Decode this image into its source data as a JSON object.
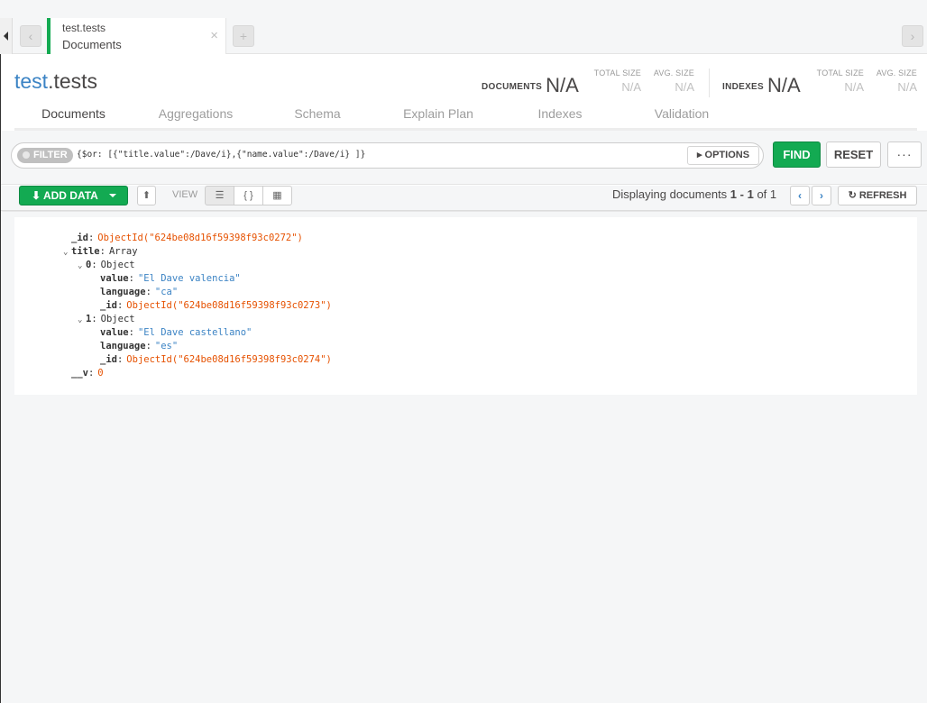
{
  "tabbar": {
    "back_icon": "chevron-left-icon",
    "forward_icon": "chevron-right-icon",
    "tab": {
      "namespace": "test.tests",
      "subtitle": "Documents",
      "close": "×"
    },
    "new_tab": "+"
  },
  "header": {
    "db": "test",
    "coll": ".tests",
    "documents_label": "DOCUMENTS",
    "documents_value": "N/A",
    "total_size_label": "TOTAL SIZE",
    "total_size_value": "N/A",
    "avg_size_label": "AVG. SIZE",
    "avg_size_value": "N/A",
    "indexes_label": "INDEXES",
    "indexes_value": "N/A",
    "idx_total_size_label": "TOTAL SIZE",
    "idx_total_size_value": "N/A",
    "idx_avg_size_label": "AVG. SIZE",
    "idx_avg_size_value": "N/A"
  },
  "subtabs": [
    "Documents",
    "Aggregations",
    "Schema",
    "Explain Plan",
    "Indexes",
    "Validation"
  ],
  "query": {
    "filter_label": "FILTER",
    "text": "{$or: [{\"title.value\":/Dave/i},{\"name.value\":/Dave/i} ]}",
    "options_label": "OPTIONS",
    "find_label": "FIND",
    "reset_label": "RESET",
    "more_label": "···"
  },
  "toolbar": {
    "add_data_label": "ADD DATA",
    "view_label": "VIEW",
    "displaying_prefix": "Displaying documents ",
    "range_start": "1",
    "range_sep": " - ",
    "range_end": "1",
    "of_label": " of ",
    "total": "1",
    "refresh_label": "REFRESH"
  },
  "document": {
    "id_key": "_id",
    "id_val": "ObjectId(\"624be08d16f59398f93c0272\")",
    "title_key": "title",
    "title_type": "Array",
    "item0_key": "0",
    "item0_type": "Object",
    "item0_value_key": "value",
    "item0_value": "\"El Dave valencia\"",
    "item0_lang_key": "language",
    "item0_lang": "\"ca\"",
    "item0_id_key": "_id",
    "item0_id": "ObjectId(\"624be08d16f59398f93c0273\")",
    "item1_key": "1",
    "item1_type": "Object",
    "item1_value_key": "value",
    "item1_value": "\"El Dave castellano\"",
    "item1_lang_key": "language",
    "item1_lang": "\"es\"",
    "item1_id_key": "_id",
    "item1_id": "ObjectId(\"624be08d16f59398f93c0274\")",
    "v_key": "__v",
    "v_val": "0"
  },
  "colors": {
    "accent_green": "#13aa52",
    "link_blue": "#3b83c4",
    "objectid_orange": "#e65100"
  }
}
